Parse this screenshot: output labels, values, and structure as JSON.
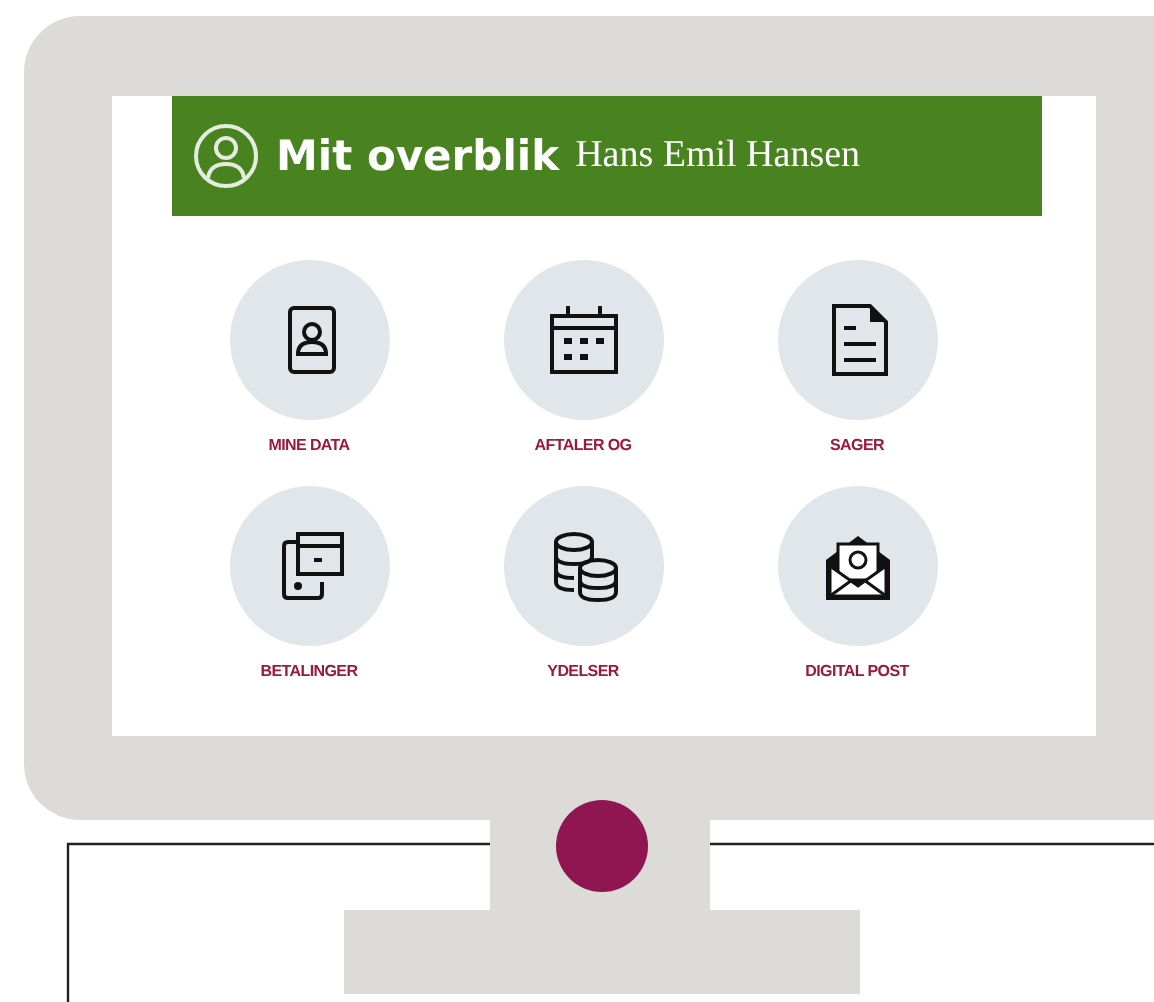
{
  "header": {
    "title": "Mit overblik",
    "user_name": "Hans Emil Hansen"
  },
  "tiles": [
    {
      "label": "MINE DATA"
    },
    {
      "label": "AFTALER OG"
    },
    {
      "label": "SAGER"
    },
    {
      "label": "BETALINGER"
    },
    {
      "label": "YDELSER"
    },
    {
      "label": "DIGITAL POST"
    }
  ]
}
